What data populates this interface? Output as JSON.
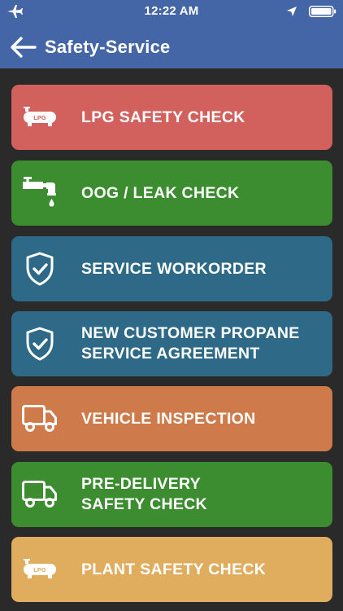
{
  "status_bar": {
    "time": "12:22 AM",
    "left_icon": "airplane-icon",
    "right_icons": [
      "location-arrow-icon",
      "battery-icon"
    ]
  },
  "header": {
    "back_icon": "back-arrow-icon",
    "title": "Safety-Service"
  },
  "menu": [
    {
      "id": "lpg-safety-check",
      "lines": [
        "LPG SAFETY CHECK"
      ],
      "icon": "lpg-tank-icon",
      "icon_text": "LPG",
      "color": "#d2605c"
    },
    {
      "id": "oog-leak-check",
      "lines": [
        "OOG / LEAK CHECK"
      ],
      "icon": "leaking-pipe-icon",
      "color": "#3c8d2f"
    },
    {
      "id": "service-workorder",
      "lines": [
        "SERVICE WORKORDER"
      ],
      "icon": "shield-check-icon",
      "color": "#2e6a88"
    },
    {
      "id": "new-customer-propane",
      "lines": [
        "NEW CUSTOMER PROPANE",
        "SERVICE AGREEMENT"
      ],
      "icon": "shield-check-icon",
      "color": "#2e6a88"
    },
    {
      "id": "vehicle-inspection",
      "lines": [
        "VEHICLE INSPECTION"
      ],
      "icon": "truck-icon",
      "color": "#cf7a4a"
    },
    {
      "id": "pre-delivery-safety-check",
      "lines": [
        "PRE-DELIVERY",
        "SAFETY CHECK"
      ],
      "icon": "truck-icon",
      "color": "#3c8d2f"
    },
    {
      "id": "plant-safety-check",
      "lines": [
        "PLANT SAFETY CHECK"
      ],
      "icon": "lpg-tank-icon",
      "icon_text": "LPG",
      "color": "#e0ad5e"
    }
  ],
  "colors": {
    "header_bg": "#4466a6",
    "page_bg": "#2a2a2a"
  }
}
